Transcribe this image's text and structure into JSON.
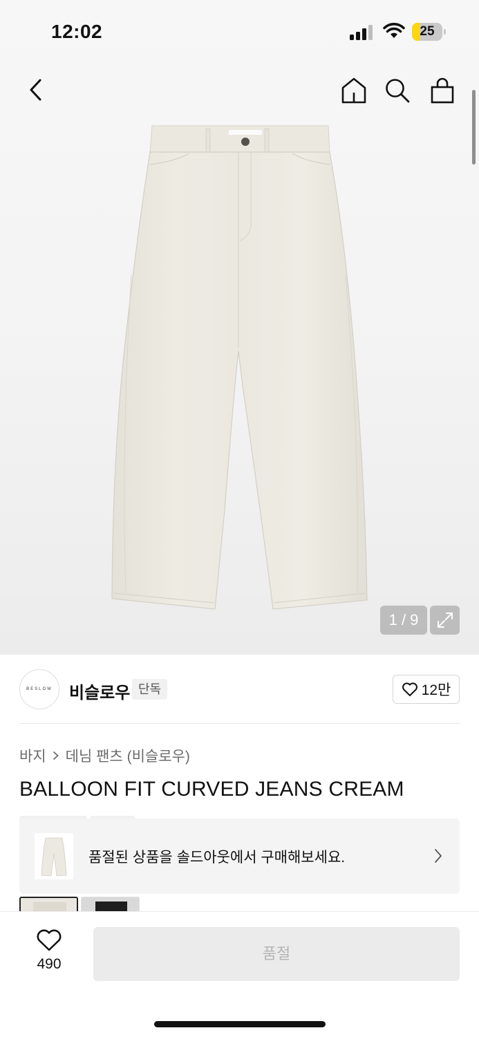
{
  "status_bar": {
    "time": "12:02",
    "battery_level": "25",
    "battery_fraction": 0.25
  },
  "top_nav": {
    "back_icon": "chevron-left-icon",
    "home_icon": "home-icon",
    "search_icon": "search-icon",
    "bag_icon": "shopping-bag-icon"
  },
  "gallery": {
    "counter": "1 / 9",
    "expand_icon": "expand-icon",
    "product_logo_text": "BESLOW"
  },
  "brand": {
    "logo_text": "BESLOW",
    "name": "비슬로우",
    "badge": "단독",
    "like_count": "12만"
  },
  "breadcrumb": {
    "items": [
      "바지",
      "데님 팬츠 (비슬로우)"
    ]
  },
  "product": {
    "title": "BALLOON FIT CURVED JEANS CREAM"
  },
  "soldout_banner": {
    "text": "품절된 상품을 솔드아웃에서 구매해보세요."
  },
  "variants": [
    {
      "color": "cream",
      "selected": true
    },
    {
      "color": "black",
      "selected": false
    }
  ],
  "bottom_bar": {
    "wish_count": "490",
    "buy_label": "품절"
  },
  "colors": {
    "accent_battery": "#ffd60a",
    "disabled_button": "#ebebeb",
    "disabled_text": "#b5b5b5",
    "product_cream": "#ece9e1"
  }
}
